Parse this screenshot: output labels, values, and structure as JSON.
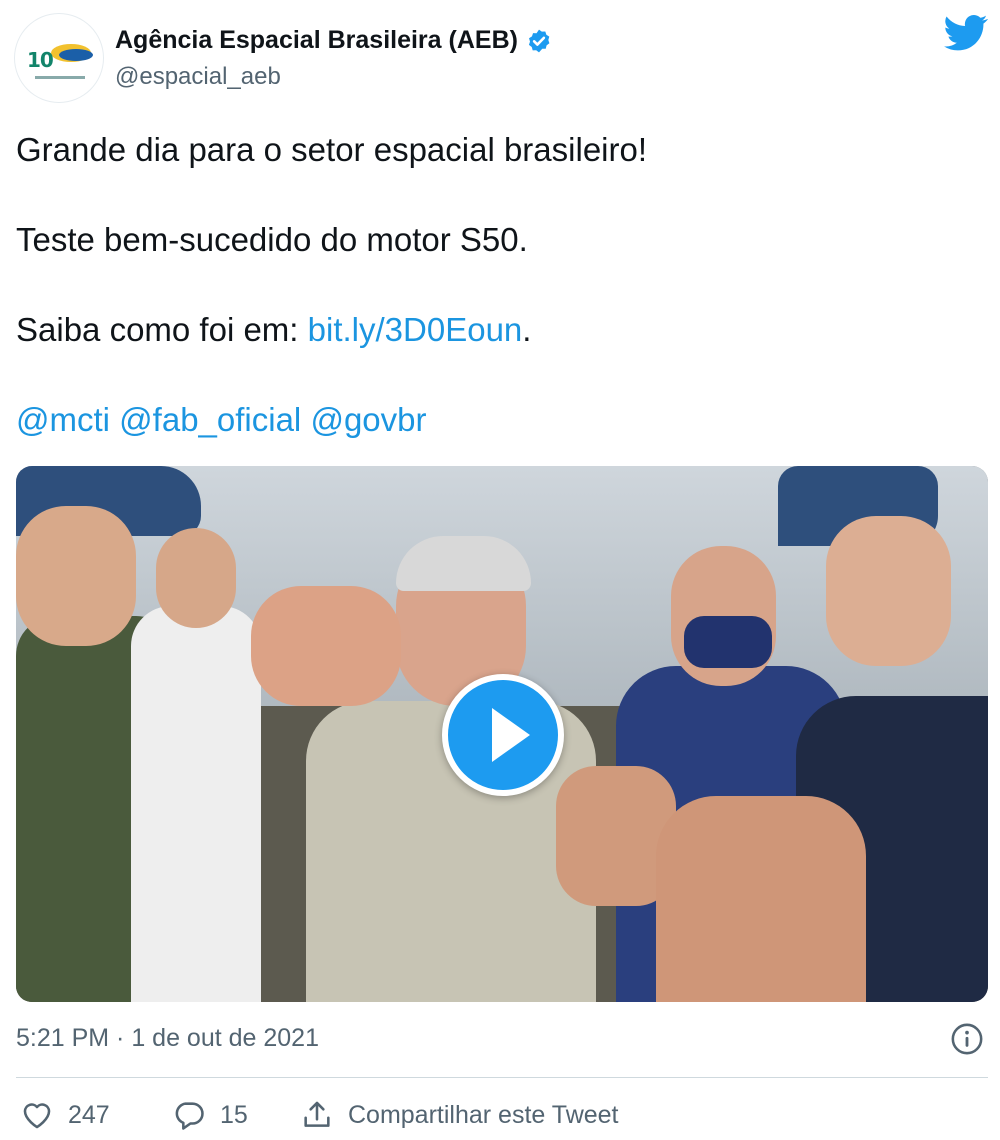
{
  "tweet": {
    "author": {
      "display_name": "Agência Espacial Brasileira (AEB)",
      "handle": "@espacial_aeb",
      "verified": true
    },
    "lines": [
      "Grande dia para o setor espacial brasileiro!",
      "Teste bem-sucedido do motor S50."
    ],
    "link_line": {
      "prefix": "Saiba como foi em: ",
      "link": "bit.ly/3D0Eoun",
      "suffix": "."
    },
    "mentions": [
      "@mcti",
      "@fab_oficial",
      "@govbr"
    ],
    "timestamp": "5:21 PM · 1 de out de 2021",
    "actions": {
      "likes": "247",
      "replies": "15",
      "share_label": "Compartilhar este Tweet"
    }
  },
  "icons": {
    "brand": "twitter-bird-icon",
    "verified": "verified-badge-icon",
    "info": "info-icon",
    "like": "heart-icon",
    "reply": "reply-bubble-icon",
    "share": "share-icon",
    "play": "play-icon"
  },
  "colors": {
    "accent": "#1d9bf0",
    "link": "#1b95e0",
    "text": "#0f1419",
    "muted": "#536471"
  }
}
